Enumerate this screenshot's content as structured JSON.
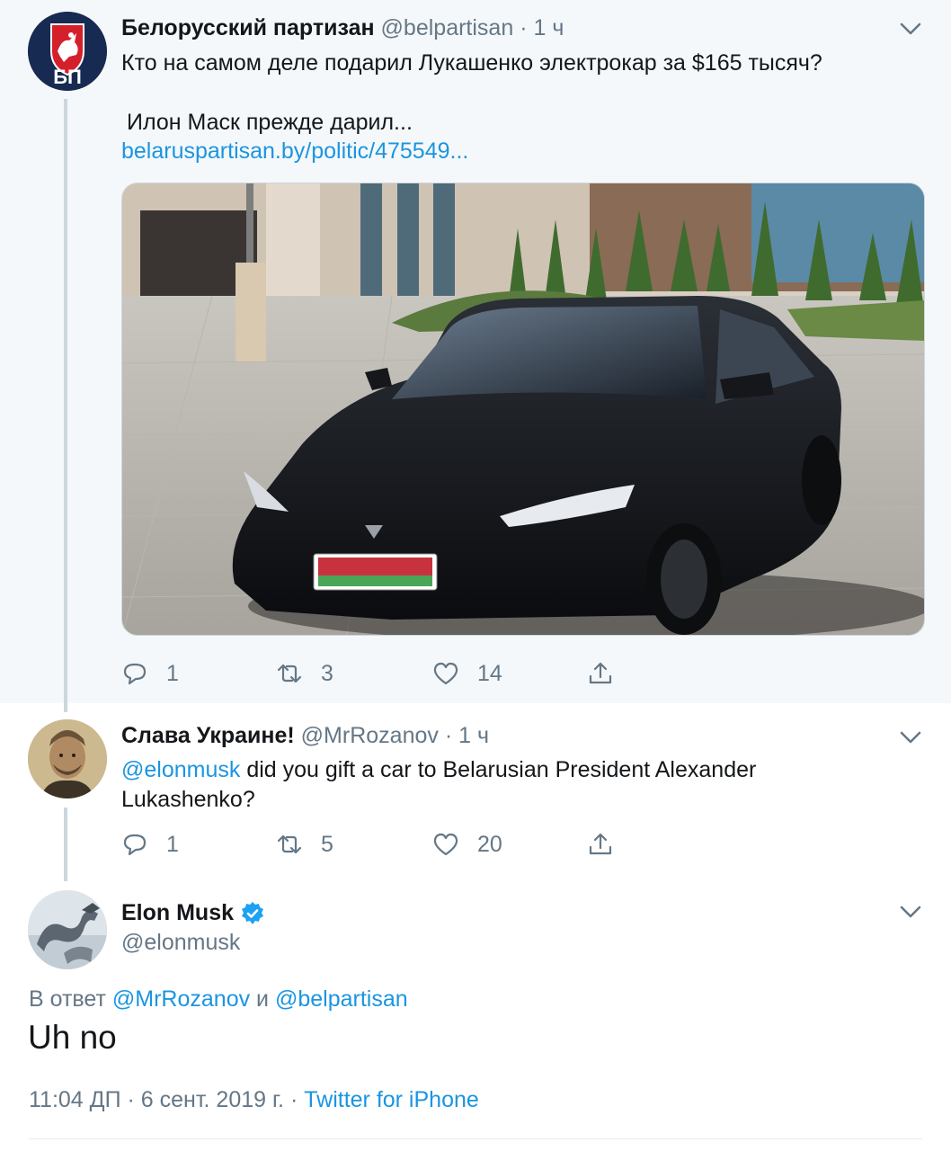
{
  "tweet1": {
    "author_name": "Белорусский партизан",
    "handle": "@belpartisan",
    "dot": "·",
    "time": "1 ч",
    "avatar_text": "БП",
    "text_line1": "Кто на самом деле подарил Лукашенко электрокар за $165 тысяч?",
    "text_line2": "Илон Маск прежде дарил...",
    "link": "belaruspartisan.by/politic/475549...",
    "replies": "1",
    "retweets": "3",
    "likes": "14"
  },
  "tweet2": {
    "author_name": "Слава Украине!",
    "handle": "@MrRozanov",
    "dot": "·",
    "time": "1 ч",
    "mention": "@elonmusk",
    "text_line1": " did you gift a car to Belarusian President Alexander",
    "text_line2": "Lukashenko?",
    "replies": "1",
    "retweets": "5",
    "likes": "20"
  },
  "tweet3": {
    "author_name": "Elon Musk",
    "handle": "@elonmusk",
    "reply_prefix": "В ответ ",
    "reply_to1": "@MrRozanov",
    "reply_and": " и ",
    "reply_to2": "@belpartisan",
    "text": "Uh no",
    "time": "11:04 ДП",
    "dot1": "·",
    "date": "6 сент. 2019 г.",
    "dot2": "·",
    "source": "Twitter for iPhone"
  },
  "colors": {
    "link": "#1b95e0",
    "muted": "#657786",
    "thread_bg": "#f5f8fa",
    "verified": "#1da1f2"
  },
  "icons": [
    "reply-icon",
    "retweet-icon",
    "like-icon",
    "share-icon",
    "chevron-down-icon",
    "verified-badge-icon"
  ]
}
